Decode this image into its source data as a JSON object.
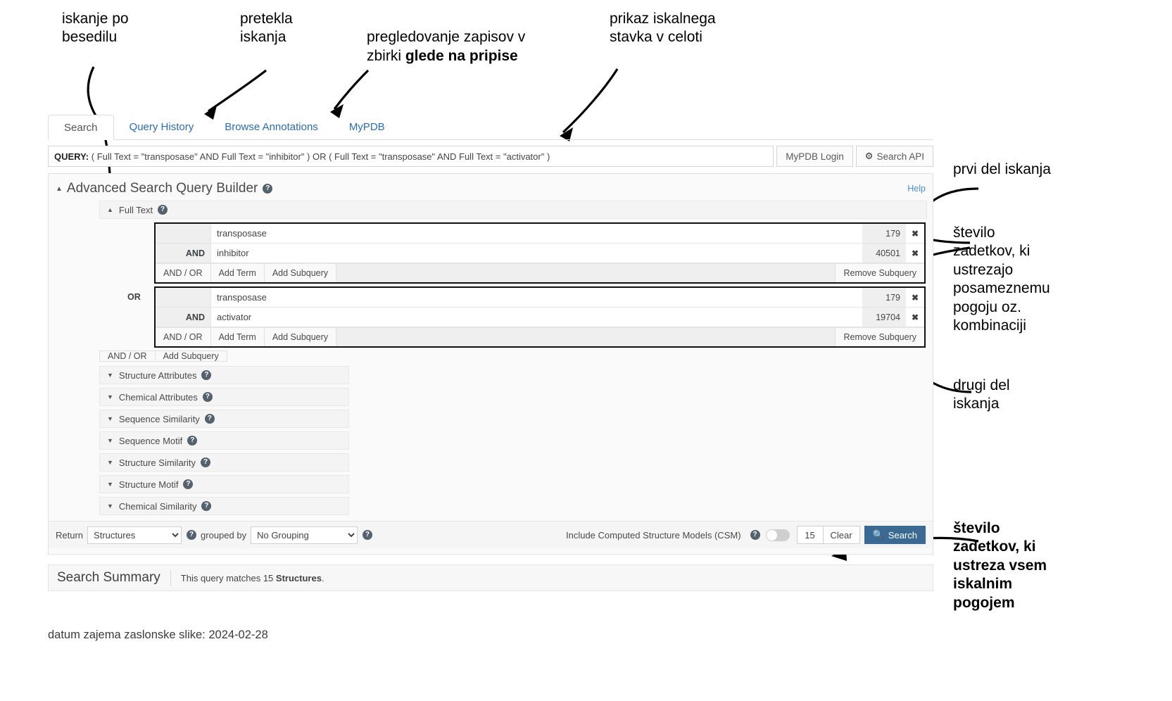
{
  "annotations": {
    "top": [
      {
        "id": "full-text-search",
        "text": "iskanje po\nbesedilu"
      },
      {
        "id": "query-history",
        "text": "pretekla\niskanja"
      },
      {
        "id": "browse-annotations-pre",
        "text": "pregledovanje zapisov v\nzbirki "
      },
      {
        "id": "browse-annotations-bold",
        "text": "glede na pripise"
      },
      {
        "id": "query-display",
        "text": "prikaz iskalnega\nstavka v celoti"
      }
    ],
    "right": [
      {
        "id": "first-part",
        "text": "prvi del iskanja"
      },
      {
        "id": "per-condition-hits",
        "text": "število\nzadetkov, ki\nustrezajo\nposameznemu\npogoju oz.\nkombinaciji"
      },
      {
        "id": "second-part",
        "text": "drugi del\niskanja"
      },
      {
        "id": "total-hits",
        "text": "število\nzadetkov, ki\nustreza vsem\niskalnim\npogojem"
      }
    ],
    "footer": "datum zajema zaslonske slike: 2024-02-28"
  },
  "tabs": [
    {
      "label": "Search",
      "active": true
    },
    {
      "label": "Query History",
      "active": false
    },
    {
      "label": "Browse Annotations",
      "active": false
    },
    {
      "label": "MyPDB",
      "active": false
    }
  ],
  "query_bar": {
    "prefix": "QUERY:",
    "full": "( Full Text = \"transposase\" AND Full Text = \"inhibitor\" ) OR ( Full Text = \"transposase\" AND Full Text = \"activator\" )",
    "mypdb_login": "MyPDB Login",
    "search_api": "Search API",
    "gear_icon": "gear-icon"
  },
  "advanced": {
    "title": "Advanced Search Query Builder",
    "help_link": "Help",
    "help_icon": "question-circle-icon",
    "full_text_label": "Full Text",
    "subqueries": [
      {
        "join": "",
        "rows": [
          {
            "op": "",
            "term": "transposase",
            "count": "179",
            "remove": "✖"
          },
          {
            "op": "AND",
            "term": "inhibitor",
            "count": "40501",
            "remove": "✖"
          }
        ],
        "tools": [
          "AND / OR",
          "Add Term",
          "Add Subquery"
        ],
        "remove_label": "Remove Subquery"
      },
      {
        "join": "OR",
        "rows": [
          {
            "op": "",
            "term": "transposase",
            "count": "179",
            "remove": "✖"
          },
          {
            "op": "AND",
            "term": "activator",
            "count": "19704",
            "remove": "✖"
          }
        ],
        "tools": [
          "AND / OR",
          "Add Term",
          "Add Subquery"
        ],
        "remove_label": "Remove Subquery"
      }
    ],
    "outer_tools": [
      "AND / OR",
      "Add Subquery"
    ],
    "sections": [
      "Structure Attributes",
      "Chemical Attributes",
      "Sequence Similarity",
      "Sequence Motif",
      "Structure Similarity",
      "Structure Motif",
      "Chemical Similarity"
    ]
  },
  "return_bar": {
    "return_label": "Return",
    "return_value": "Structures",
    "grouped_by_label": "grouped by",
    "grouping_value": "No Grouping",
    "csm_label": "Include Computed Structure Models (CSM)",
    "csm_toggle_state": "off",
    "result_count": "15",
    "clear_label": "Clear",
    "search_label": "Search",
    "search_icon": "magnifier-icon"
  },
  "summary": {
    "title": "Search Summary",
    "text_pre": "This query matches 15 ",
    "text_bold": "Structures",
    "text_post": "."
  },
  "colors": {
    "link_blue": "#2b6cb8",
    "search_button": "#3a6a94",
    "magnifier_green": "#6ee06e"
  }
}
